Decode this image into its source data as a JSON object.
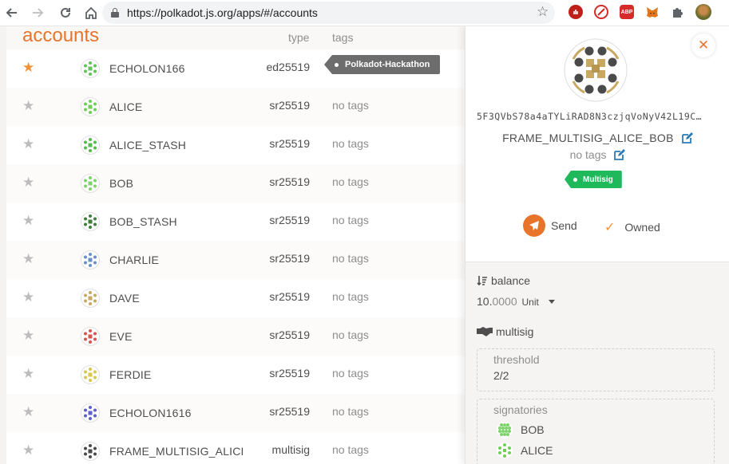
{
  "browser": {
    "url": "https://polkadot.js.org/apps/#/accounts"
  },
  "page": {
    "title": "accounts",
    "columns": {
      "type": "type",
      "tags": "tags"
    }
  },
  "accounts": [
    {
      "name": "ECHOLON166",
      "type": "ed25519",
      "tag": "Polkadot-Hackathon",
      "favorite": true,
      "color": "#5fc55a"
    },
    {
      "name": "ALICE",
      "type": "sr25519",
      "tag": "no tags",
      "favorite": false,
      "color": "#6fcf55"
    },
    {
      "name": "ALICE_STASH",
      "type": "sr25519",
      "tag": "no tags",
      "favorite": false,
      "color": "#54bb4e"
    },
    {
      "name": "BOB",
      "type": "sr25519",
      "tag": "no tags",
      "favorite": false,
      "color": "#7dd36b"
    },
    {
      "name": "BOB_STASH",
      "type": "sr25519",
      "tag": "no tags",
      "favorite": false,
      "color": "#3f7f3a"
    },
    {
      "name": "CHARLIE",
      "type": "sr25519",
      "tag": "no tags",
      "favorite": false,
      "color": "#6b8fc9"
    },
    {
      "name": "DAVE",
      "type": "sr25519",
      "tag": "no tags",
      "favorite": false,
      "color": "#c9a961"
    },
    {
      "name": "EVE",
      "type": "sr25519",
      "tag": "no tags",
      "favorite": false,
      "color": "#d9534f"
    },
    {
      "name": "FERDIE",
      "type": "sr25519",
      "tag": "no tags",
      "favorite": false,
      "color": "#d9c64a"
    },
    {
      "name": "ECHOLON1616",
      "type": "sr25519",
      "tag": "no tags",
      "favorite": false,
      "color": "#5b5fd0"
    },
    {
      "name": "FRAME_MULTISIG_ALICE_BOB",
      "type": "multisig",
      "tag": "no tags",
      "favorite": false,
      "color": "#4a4a4a"
    }
  ],
  "panel": {
    "address": "5F3QVbS78a4aTYLiRAD8N3czjqVoNyV42L19C…",
    "name": "FRAME_MULTISIG_ALICE_BOB",
    "tags": "no tags",
    "tag_badge": "Multisig",
    "send_label": "Send",
    "owned_label": "Owned",
    "balance_label": "balance",
    "balance_int": "10.",
    "balance_dec": "0000",
    "balance_unit": "Unit",
    "multisig_label": "multisig",
    "threshold_label": "threshold",
    "threshold_value": "2/2",
    "signatories_label": "signatories",
    "signatories": [
      "BOB",
      "ALICE"
    ]
  },
  "colors": {
    "accent": "#e8742c",
    "star_active": "#f19135",
    "tag_green": "#1fb85b",
    "tag_dark": "#6d6d6d"
  },
  "icons": {
    "back": "arrow-left-icon",
    "forward": "arrow-right-icon",
    "reload": "reload-icon",
    "home": "home-icon",
    "lock": "lock-icon",
    "bookmark": "star-outline-icon",
    "extensions": [
      "ublock-icon",
      "block-icon",
      "adblock-plus-icon",
      "metamask-icon",
      "puzzle-icon",
      "profile-avatar"
    ]
  }
}
